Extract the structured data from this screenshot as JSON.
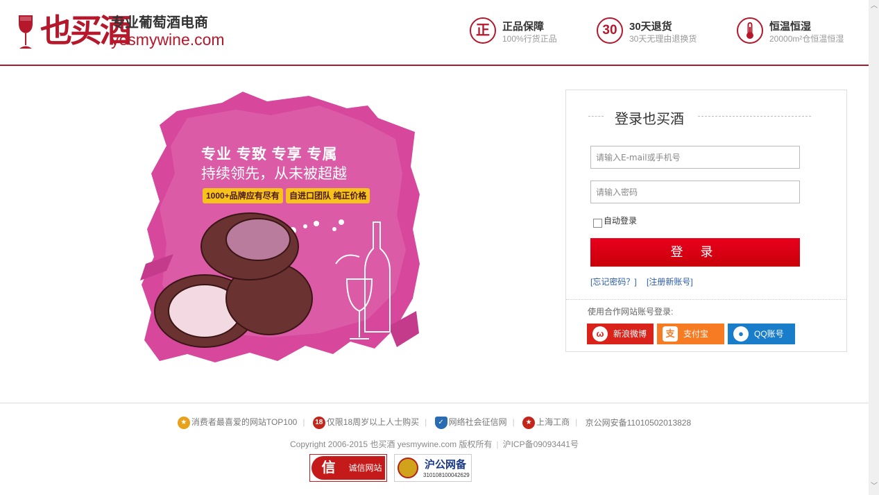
{
  "header": {
    "brand_cn": "也买酒",
    "slogan": "专业葡萄酒电商",
    "domain": "yesmywine.com",
    "features": [
      {
        "icon_text": "正",
        "icon": "genuine-icon",
        "title": "正品保障",
        "desc": "100%行货正品"
      },
      {
        "icon_text": "30",
        "icon": "return-30-icon",
        "title": "30天退货",
        "desc": "30天无理由退换货"
      },
      {
        "icon_text": "🌡",
        "icon": "thermometer-icon",
        "title": "恒温恒湿",
        "desc": "20000m²仓恒温恒湿"
      }
    ]
  },
  "promo": {
    "line1": "专业 专致 专享 专属",
    "line2": "持续领先，从未被超越",
    "tag1": "1000+品牌应有尽有",
    "tag2": "自进口团队 纯正价格",
    "colors": {
      "splash": "#d7479c",
      "barrel": "#5a2a2a"
    }
  },
  "login": {
    "title": "登录也买酒",
    "account_placeholder": "请输入E-mail或手机号",
    "password_placeholder": "请输入密码",
    "remember_label": "自动登录",
    "submit_label": "登 录",
    "forgot_label": "[忘记密码？]",
    "register_label": "[注册新账号]",
    "partner_label": "使用合作网站账号登录:",
    "partners": [
      {
        "label": "新浪微博",
        "icon": "weibo-icon"
      },
      {
        "label": "支付宝",
        "icon": "alipay-icon"
      },
      {
        "label": "QQ账号",
        "icon": "qq-icon"
      }
    ]
  },
  "footer": {
    "items": [
      {
        "label": "消费者最喜爱的网站TOP100",
        "icon": "top100-icon"
      },
      {
        "label": "仅限18周岁以上人士购买",
        "icon_text": "18",
        "icon": "age-18-icon"
      },
      {
        "label": "网络社会征信网",
        "icon": "shield-icon"
      },
      {
        "label": "上海工商",
        "icon": "emblem-icon"
      },
      {
        "label": "京公网安备11010502013828"
      }
    ],
    "copyright": "Copyright 2006-2015 也买酒 yesmywine.com 版权所有",
    "icp": "沪ICP备09093441号",
    "badge1_icon": "信",
    "badge1_text": "诚信网站",
    "badge2_title": "沪公网备",
    "badge2_number": "310108100042629"
  },
  "accent_colors": {
    "brand": "#b5172b",
    "login_button": "#e8001c",
    "link": "#2a5caa"
  }
}
